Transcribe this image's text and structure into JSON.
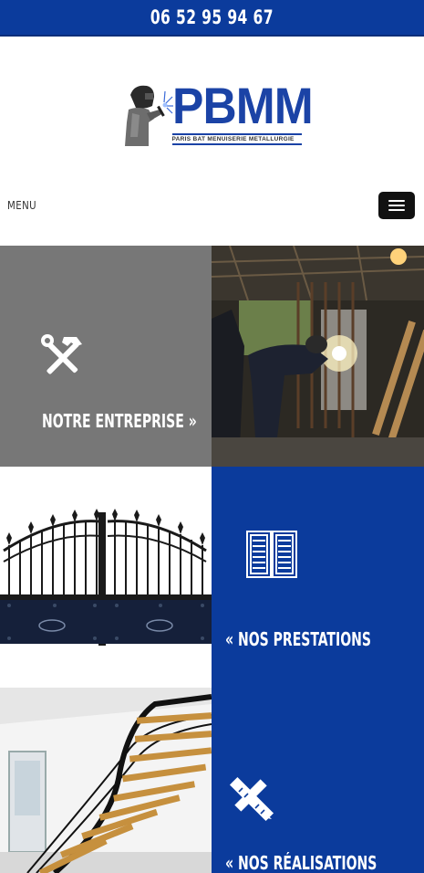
{
  "topbar": {
    "phone": "06 52 95 94 67"
  },
  "logo": {
    "brand": "PBMM",
    "tagline": "PARIS BAT MENUISERIE METALLURGIE",
    "icon": "welder-icon"
  },
  "menu": {
    "label": "MENU",
    "icon": "hamburger-icon"
  },
  "tiles": {
    "entreprise": {
      "label": "NOTRE ENTREPRISE »",
      "icon": "tools-icon"
    },
    "prestations": {
      "label": "« NOS PRESTATIONS",
      "icon": "shutters-icon"
    },
    "realisations": {
      "label": "« NOS RÉALISATIONS",
      "icon": "ruler-pencil-icon"
    }
  },
  "colors": {
    "brand_blue": "#0b3b9c",
    "gray": "#777777",
    "dark": "#111111"
  }
}
